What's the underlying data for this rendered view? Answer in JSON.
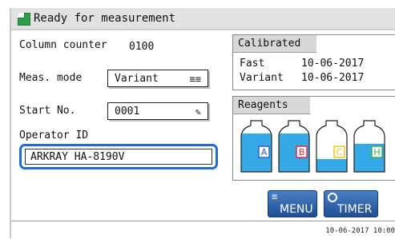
{
  "title": {
    "text": "Ready for measurement"
  },
  "column_counter": {
    "label": "Column counter",
    "value": "0100"
  },
  "meas_mode": {
    "label": "Meas. mode",
    "value": "Variant"
  },
  "start_no": {
    "label": "Start No.",
    "value": "0001"
  },
  "operator": {
    "label": "Operator ID",
    "value": "ARKRAY HA-8190V"
  },
  "calibrated": {
    "title": "Calibrated",
    "rows": [
      {
        "name": "Fast",
        "date": "10-06-2017"
      },
      {
        "name": "Variant",
        "date": "10-06-2017"
      }
    ]
  },
  "reagents": {
    "title": "Reagents",
    "bottles": [
      {
        "letter": "A",
        "level": 0.75,
        "color": "#2a5fd1"
      },
      {
        "letter": "B",
        "level": 0.75,
        "color": "#e0243c"
      },
      {
        "letter": "C",
        "level": 0.25,
        "color": "#f2c200"
      },
      {
        "letter": "H",
        "level": 0.55,
        "color": "#2fb24a"
      }
    ]
  },
  "buttons": {
    "menu": "MENU",
    "timer": "TIMER"
  },
  "status": {
    "datetime": "10-06-2017 10:00"
  },
  "colors": {
    "accent": "#1f6fd1",
    "button": "#2d5fa8",
    "liquid": "#36a8e6"
  }
}
